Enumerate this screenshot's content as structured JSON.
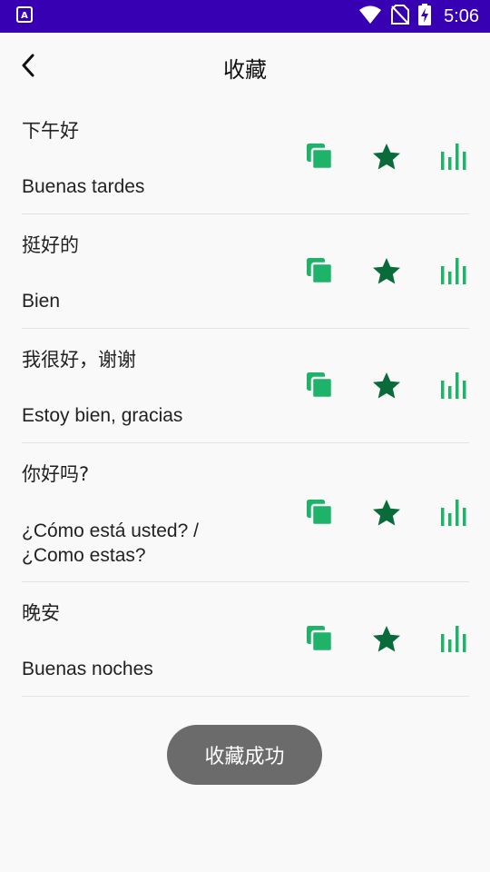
{
  "status_bar": {
    "time": "5:06",
    "icons": [
      "app-notification-icon",
      "wifi-icon",
      "no-sim-icon",
      "battery-charging-icon"
    ]
  },
  "header": {
    "back_icon": "chevron-left-icon",
    "title": "收藏"
  },
  "phrases": [
    {
      "chinese": "下午好",
      "spanish": "Buenas tardes",
      "favorited": true
    },
    {
      "chinese": "挺好的",
      "spanish": "Bien",
      "favorited": true
    },
    {
      "chinese": "我很好，谢谢",
      "spanish": "Estoy bien, gracias",
      "favorited": true
    },
    {
      "chinese": "你好吗?",
      "spanish": "¿Cómo está usted? / ¿Como estas?",
      "favorited": true
    },
    {
      "chinese": "晚安",
      "spanish": "Buenas noches",
      "favorited": true
    }
  ],
  "row_actions": {
    "copy_icon": "copy-icon",
    "favorite_icon": "star-icon",
    "play_icon": "audio-bars-icon"
  },
  "colors": {
    "status_bar": "#3700b3",
    "copy_icon": "#1fb36a",
    "star_icon": "#0a6b3a",
    "audio_icon": "#1fb36a",
    "toast_bg": "#6b6b6b"
  },
  "toast": {
    "message": "收藏成功"
  }
}
